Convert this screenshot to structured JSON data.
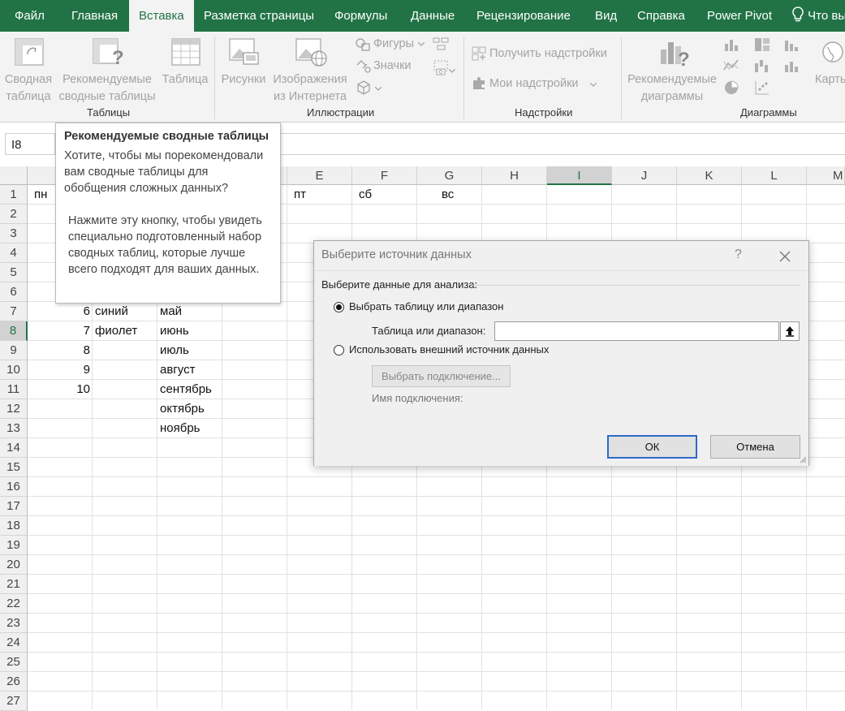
{
  "menu": {
    "tabs": [
      "Файл",
      "Главная",
      "Вставка",
      "Разметка страницы",
      "Формулы",
      "Данные",
      "Рецензирование",
      "Вид",
      "Справка",
      "Power Pivot"
    ],
    "active_tab": "Вставка",
    "search": "Что вы"
  },
  "ribbon": {
    "pivot_table": "Сводная таблица",
    "recommended_pivots": "Рекомендуемые сводные таблицы",
    "table": "Таблица",
    "group_tables": "Таблицы",
    "pictures": "Рисунки",
    "online_pictures": "Изображения из Интернета",
    "shapes": "Фигуры",
    "icons": "Значки",
    "group_illustrations": "Иллюстрации",
    "get_addins": "Получить надстройки",
    "my_addins": "Мои надстройки",
    "group_addins": "Надстройки",
    "recommended_charts": "Рекомендуемые диаграммы",
    "maps": "Карты",
    "group_charts": "Диаграммы"
  },
  "namebox": "I8",
  "grid": {
    "columns": [
      "E",
      "F",
      "G",
      "H",
      "I",
      "J",
      "K",
      "L",
      "M"
    ],
    "selected_column": "I",
    "rows": [
      "1",
      "2",
      "3",
      "4",
      "5",
      "6",
      "7",
      "8",
      "9",
      "10",
      "11",
      "12",
      "13",
      "14",
      "15",
      "16",
      "17",
      "18",
      "19",
      "20",
      "21",
      "22",
      "23",
      "24",
      "25",
      "26",
      "27"
    ],
    "selected_row": "8",
    "row1": {
      "a": "пн",
      "e": "пт",
      "f": "сб",
      "g": "вс"
    },
    "numbers": [
      "6",
      "7",
      "8",
      "9",
      "10"
    ],
    "colors": [
      "синий",
      "фиолет"
    ],
    "months": [
      "май",
      "июнь",
      "июль",
      "август",
      "сентябрь",
      "октябрь",
      "ноябрь"
    ]
  },
  "tooltip": {
    "title": "Рекомендуемые сводные таблицы",
    "p1": "Хотите, чтобы мы порекомендовали вам сводные таблицы для обобщения сложных данных?",
    "p2": "Нажмите эту кнопку, чтобы увидеть специально подготовленный набор сводных таблиц, которые лучше всего подходят для ваших данных."
  },
  "dialog": {
    "title": "Выберите источник данных",
    "help": "?",
    "section": "Выберите данные для анализа:",
    "option_table": "Выбрать таблицу или диапазон",
    "range_label": "Таблица или диапазон:",
    "range_value": "",
    "option_external": "Использовать внешний источник данных",
    "choose_connection": "Выбрать подключение...",
    "connection_name": "Имя подключения:",
    "ok": "ОК",
    "cancel": "Отмена"
  }
}
